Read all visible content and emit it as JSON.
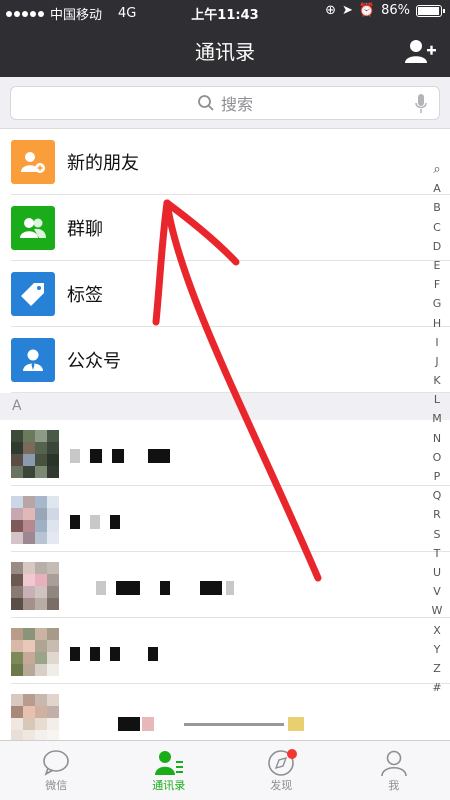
{
  "status_bar": {
    "carrier": "中国移动",
    "network": "4G",
    "time": "上午11:43",
    "battery": "86%",
    "battery_level": 0.86
  },
  "header": {
    "title": "通讯录",
    "add_icon": "add-friend-icon"
  },
  "search": {
    "placeholder": "搜索"
  },
  "functions": [
    {
      "label": "新的朋友",
      "icon": "new-friends-icon",
      "color": "#fa9d3b"
    },
    {
      "label": "群聊",
      "icon": "group-chat-icon",
      "color": "#1aad19"
    },
    {
      "label": "标签",
      "icon": "tag-icon",
      "color": "#2782d7"
    },
    {
      "label": "公众号",
      "icon": "official-account-icon",
      "color": "#2782d7"
    }
  ],
  "section_letter": "A",
  "index_letters": [
    "Q",
    "A",
    "B",
    "C",
    "D",
    "E",
    "F",
    "G",
    "H",
    "I",
    "J",
    "K",
    "L",
    "M",
    "N",
    "O",
    "P",
    "Q",
    "R",
    "S",
    "T",
    "U",
    "V",
    "W",
    "X",
    "Y",
    "Z",
    "#"
  ],
  "tabs": [
    {
      "label": "微信",
      "icon": "chat-bubble-icon"
    },
    {
      "label": "通讯录",
      "icon": "contacts-icon"
    },
    {
      "label": "发现",
      "icon": "compass-icon"
    },
    {
      "label": "我",
      "icon": "profile-icon"
    }
  ],
  "colors": {
    "header_bg": "#2e2e33",
    "accent_green": "#1aad19",
    "annotation_red": "#e8262b"
  }
}
